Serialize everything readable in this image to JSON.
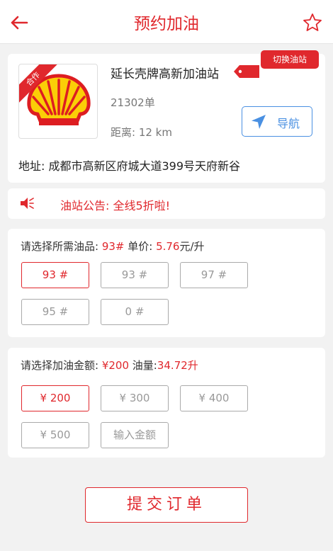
{
  "header": {
    "title": "预约加油",
    "accent_color": "#e0282d",
    "back_icon": "arrow-left-icon",
    "fav_icon": "star-outline-icon"
  },
  "station": {
    "badge": "合作",
    "name": "延长壳牌高新加油站",
    "switch_label": "切换油站",
    "orders": "21302单",
    "distance": "距离: 12 km",
    "nav_label": "导航",
    "address": "地址: 成都市高新区府城大道399号天府新谷"
  },
  "notice": {
    "text": "油站公告: 全线5折啦!"
  },
  "fuel": {
    "label_prefix": "请选择所需油品: ",
    "selected": "93#",
    "price_prefix": " 单价: ",
    "price": "5.76",
    "price_unit": "元/升",
    "options": [
      "93 #",
      "93 #",
      "97 #",
      "95 #",
      "0 #"
    ]
  },
  "amount": {
    "label_prefix": "请选择加油金额: ",
    "selected": "¥200",
    "volume_prefix": " 油量:",
    "volume": "34.72升",
    "options": [
      "¥ 200",
      "¥ 300",
      "¥ 400",
      "¥ 500",
      "输入金额"
    ]
  },
  "submit_label": "提交订单"
}
